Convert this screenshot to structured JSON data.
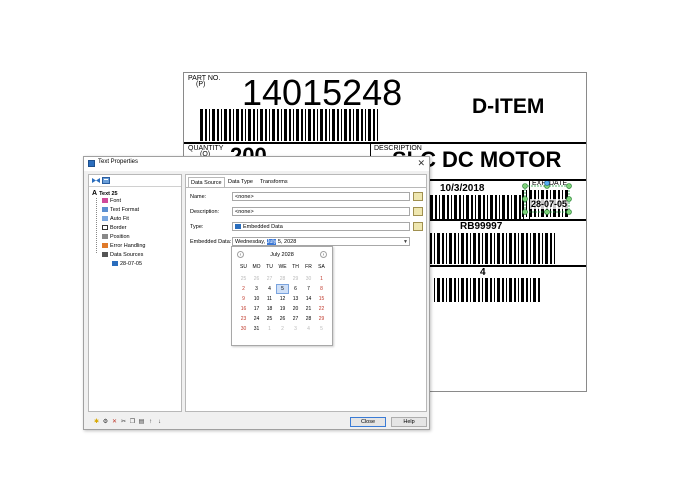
{
  "label": {
    "part_no_label": "PART NO.",
    "part_no_sub": "(P)",
    "part_number": "14015248",
    "item": "D-ITEM",
    "quantity_label": "QUANTITY",
    "quantity_sub": "(Q)",
    "quantity_value": "200",
    "description_label": "DESCRIPTION",
    "description_partial": "SLC",
    "description": "DC MOTOR",
    "date_value": "10/3/2018",
    "exp_date_label": "EXP. DATE",
    "exp_date_value": "28-07-05",
    "lot_value": "RB99997",
    "count_value": "4"
  },
  "dialog": {
    "title": "Text Properties",
    "close_glyph": "✕",
    "tree": {
      "root": "Text 25",
      "items": [
        "Font",
        "Text Format",
        "Auto Fit",
        "Border",
        "Position",
        "Error Handling",
        "Data Sources"
      ],
      "sub_item": "28-07-05"
    },
    "tabs": [
      "Data Source",
      "Data Type",
      "Transforms"
    ],
    "fields": {
      "name_label": "Name:",
      "name_value": "<none>",
      "description_label": "Description:",
      "description_value": "<none>",
      "type_label": "Type:",
      "type_value": "Embedded Data",
      "embedded_label": "Embedded Data:",
      "embedded_before": "Wednesday, ",
      "embedded_selected": "July",
      "embedded_after": " 5, 2028"
    },
    "calendar": {
      "month_title": "July 2028",
      "prev": "‹",
      "next": "›",
      "weekdays": [
        "SU",
        "MO",
        "TU",
        "WE",
        "TH",
        "FR",
        "SA"
      ],
      "weeks": [
        [
          "25",
          "26",
          "27",
          "28",
          "29",
          "30",
          "1"
        ],
        [
          "2",
          "3",
          "4",
          "5",
          "6",
          "7",
          "8"
        ],
        [
          "9",
          "10",
          "11",
          "12",
          "13",
          "14",
          "15"
        ],
        [
          "16",
          "17",
          "18",
          "19",
          "20",
          "21",
          "22"
        ],
        [
          "23",
          "24",
          "25",
          "26",
          "27",
          "28",
          "29"
        ],
        [
          "30",
          "31",
          "1",
          "2",
          "3",
          "4",
          "5"
        ]
      ],
      "selected_day": "5"
    },
    "buttons": {
      "close": "Close",
      "help": "Help"
    },
    "colors": {
      "accent": "#3b78d6",
      "weekend": "#c0392b",
      "selected_bg": "#cfe0f8"
    }
  }
}
